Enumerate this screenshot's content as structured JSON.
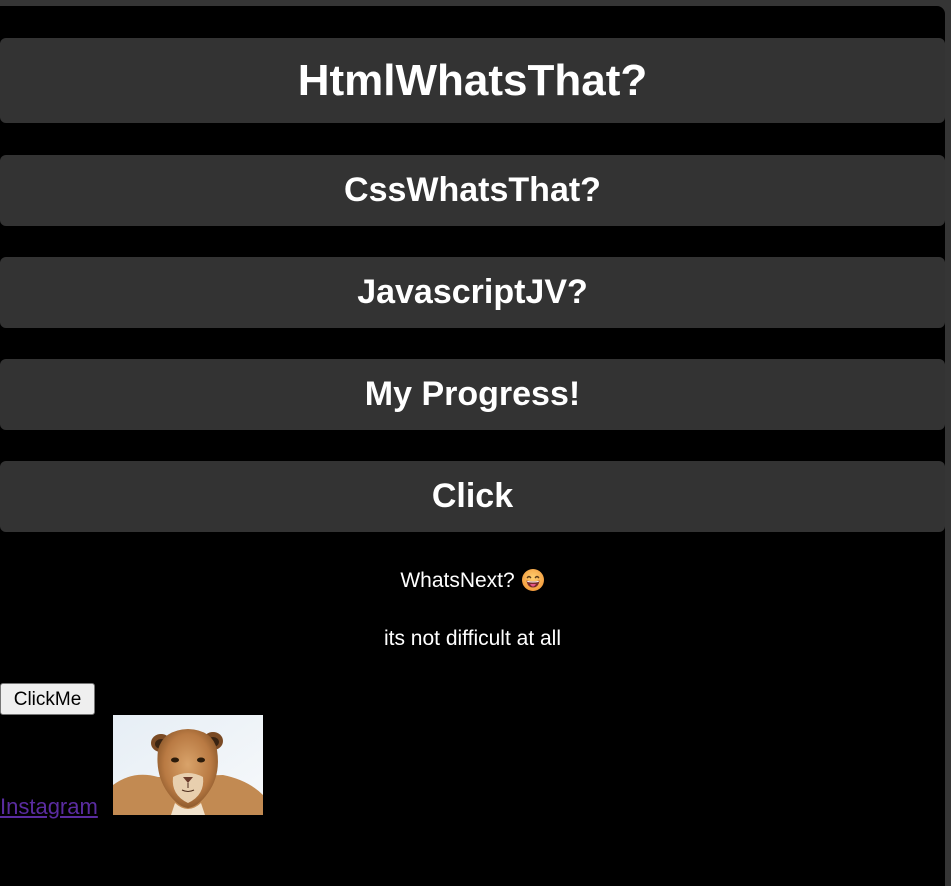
{
  "headings": {
    "html": "HtmlWhatsThat?",
    "css": "CssWhatsThat?",
    "javascript": "JavascriptJV?",
    "progress": "My Progress!",
    "click": "Click"
  },
  "body_text": {
    "whats_next": "WhatsNext?",
    "not_difficult": "its not difficult at all"
  },
  "button": {
    "label": "ClickMe"
  },
  "link": {
    "label": "Instagram"
  },
  "image": {
    "icon": "lioness-photo"
  },
  "emoji": {
    "icon": "grinning-tongue-emoji"
  },
  "colors": {
    "background": "#000000",
    "bar": "#333333",
    "text": "#ffffff",
    "link": "#5a2ca0"
  }
}
